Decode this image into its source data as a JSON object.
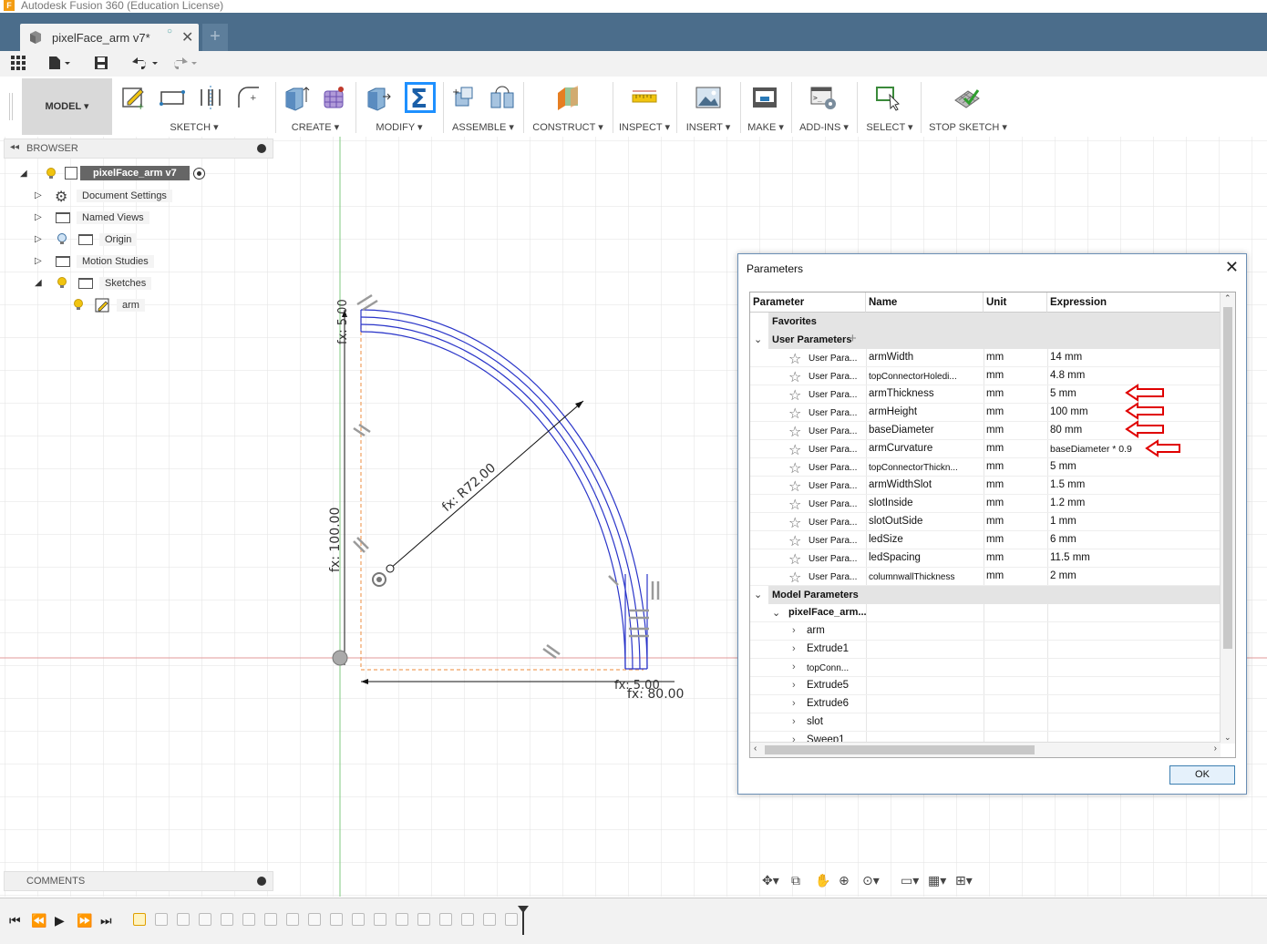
{
  "window": {
    "title": "Autodesk Fusion 360 (Education License)"
  },
  "tab": {
    "label": "pixelFace_arm v7*",
    "add": "+"
  },
  "toolbar": {
    "workspace": "MODEL",
    "groups": [
      {
        "label": "SKETCH"
      },
      {
        "label": "CREATE"
      },
      {
        "label": "MODIFY"
      },
      {
        "label": "ASSEMBLE"
      },
      {
        "label": "CONSTRUCT"
      },
      {
        "label": "INSPECT"
      },
      {
        "label": "INSERT"
      },
      {
        "label": "MAKE"
      },
      {
        "label": "ADD-INS"
      },
      {
        "label": "SELECT"
      },
      {
        "label": "STOP SKETCH"
      }
    ]
  },
  "browser": {
    "title": "BROWSER",
    "root": "pixelFace_arm v7",
    "items": [
      {
        "label": "Document Settings"
      },
      {
        "label": "Named Views"
      },
      {
        "label": "Origin"
      },
      {
        "label": "Motion Studies"
      },
      {
        "label": "Sketches"
      },
      {
        "label": "arm"
      }
    ]
  },
  "comments": {
    "title": "COMMENTS"
  },
  "sketch": {
    "dim_height": "fx: 100.00",
    "dim_radius": "fx: R72.00",
    "dim_width": "fx: 80.00",
    "dim_top": "fx: 5.00",
    "dim_bottom": "fx: 5.00",
    "colors": {
      "curve": "#2a35c9",
      "construction": "#f0a060",
      "axis_red": "#d04040",
      "axis_green": "#50b050"
    }
  },
  "parameters": {
    "title": "Parameters",
    "columns": [
      "Parameter",
      "Name",
      "Unit",
      "Expression"
    ],
    "favorites": "Favorites",
    "user_group": "User Parameters",
    "user_params": [
      {
        "type": "User Para...",
        "name": "armWidth",
        "unit": "mm",
        "expr": "14 mm"
      },
      {
        "type": "User Para...",
        "name": "topConnectorHoledi...",
        "unit": "mm",
        "expr": "4.8 mm"
      },
      {
        "type": "User Para...",
        "name": "armThickness",
        "unit": "mm",
        "expr": "5 mm"
      },
      {
        "type": "User Para...",
        "name": "armHeight",
        "unit": "mm",
        "expr": "100 mm"
      },
      {
        "type": "User Para...",
        "name": "baseDiameter",
        "unit": "mm",
        "expr": "80 mm"
      },
      {
        "type": "User Para...",
        "name": "armCurvature",
        "unit": "mm",
        "expr": "baseDiameter * 0.9"
      },
      {
        "type": "User Para...",
        "name": "topConnectorThickn...",
        "unit": "mm",
        "expr": "5 mm"
      },
      {
        "type": "User Para...",
        "name": "armWidthSlot",
        "unit": "mm",
        "expr": "1.5 mm"
      },
      {
        "type": "User Para...",
        "name": "slotInside",
        "unit": "mm",
        "expr": "1.2 mm"
      },
      {
        "type": "User Para...",
        "name": "slotOutSide",
        "unit": "mm",
        "expr": "1 mm"
      },
      {
        "type": "User Para...",
        "name": "ledSize",
        "unit": "mm",
        "expr": "6 mm"
      },
      {
        "type": "User Para...",
        "name": "ledSpacing",
        "unit": "mm",
        "expr": "11.5 mm"
      },
      {
        "type": "User Para...",
        "name": "columnwallThickness",
        "unit": "mm",
        "expr": "2 mm"
      }
    ],
    "model_group": "Model Parameters",
    "model_root": "pixelFace_arm...",
    "model_items": [
      "arm",
      "Extrude1",
      "topConn...",
      "Extrude5",
      "Extrude6",
      "slot",
      "Sweep1"
    ],
    "ok": "OK"
  }
}
